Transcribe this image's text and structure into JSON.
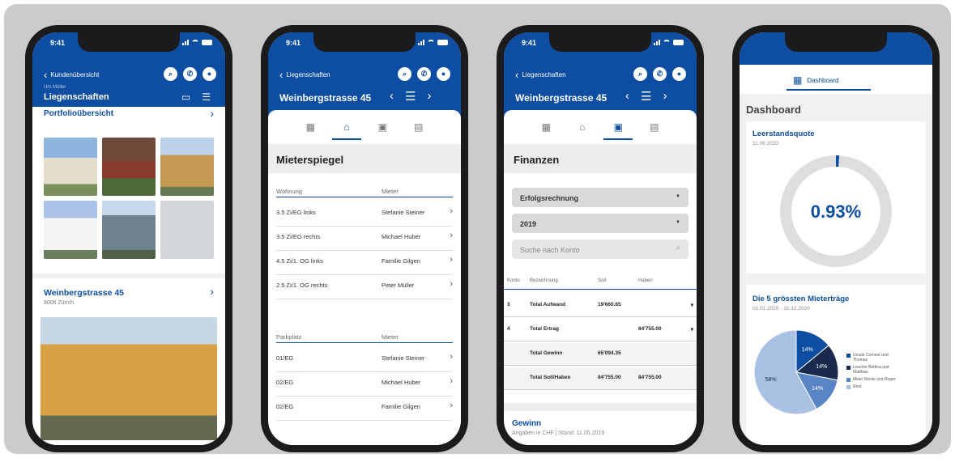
{
  "status": {
    "time": "9:41"
  },
  "colors": {
    "primary": "#0d4ea3",
    "dark_navy": "#1a2a4f",
    "mid_blue": "#5a85c4",
    "light_blue": "#a9c1e3",
    "ring_gray": "#dedede"
  },
  "screen1": {
    "back_label": "Kundenübersicht",
    "user": "Urs Müller",
    "title": "Liegenschaften",
    "section": "Portfolioübersicht",
    "property_name": "Weinbergstrasse 45",
    "property_city": "8006 Zürich",
    "icons": [
      "search-icon",
      "phone-icon",
      "user-icon",
      "monitor-icon",
      "list-icon"
    ]
  },
  "screen2": {
    "back_label": "Liegenschaften",
    "title": "Weinbergstrasse 45",
    "page_title": "Mieterspiegel",
    "col_unit": "Wohnung",
    "col_tenant": "Mieter",
    "apartments": [
      {
        "unit": "3.5 Zi/EG links",
        "tenant": "Stefanie Steiner"
      },
      {
        "unit": "3.5 Zi/EG rechts",
        "tenant": "Michael Huber"
      },
      {
        "unit": "4.5 Zi/1. OG links",
        "tenant": "Familie Gilgen"
      },
      {
        "unit": "2.5 Zi/1. OG rechts",
        "tenant": "Peter Müller"
      }
    ],
    "col_parking": "Parkplatz",
    "col_tenant2": "Mieter",
    "parking": [
      {
        "unit": "01/EG",
        "tenant": "Stefanie Steiner"
      },
      {
        "unit": "02/EG",
        "tenant": "Michael Huber"
      },
      {
        "unit": "02/EG",
        "tenant": "Familie Gilgen"
      }
    ]
  },
  "screen3": {
    "back_label": "Liegenschaften",
    "title": "Weinbergstrasse 45",
    "page_title": "Finanzen",
    "select_type": "Erfolgsrechnung",
    "select_year": "2019",
    "search_placeholder": "Suche nach Konto",
    "headers": {
      "konto": "Konto",
      "bez": "Bezeichnung",
      "soll": "Soll",
      "haben": "Haben"
    },
    "rows": [
      {
        "konto": "3",
        "bez": "Total Aufwand",
        "soll": "19'660.65",
        "haben": ""
      },
      {
        "konto": "4",
        "bez": "Total Ertrag",
        "soll": "",
        "haben": "84'755.00"
      },
      {
        "konto": "",
        "bez": "Total Gewinn",
        "soll": "65'094.35",
        "haben": ""
      },
      {
        "konto": "",
        "bez": "Total Soll/Haben",
        "soll": "84'755.00",
        "haben": "84'755.00"
      }
    ],
    "gewinn_title": "Gewinn",
    "gewinn_sub": "Angaben in CHF | Stand: 11.05.2019"
  },
  "screen4": {
    "tab_label": "Dashboard",
    "page_title": "Dashboard",
    "card1_title": "Leerstandsquote",
    "card1_date": "11.06.2020",
    "vacancy_value": "0.93%",
    "vacancy_fraction": 0.0093,
    "card2_title": "Die 5 grössten Mieterträge",
    "card2_date": "01.01.2020 - 31.12.2020",
    "chart_data": {
      "type": "pie",
      "slices": [
        {
          "label": "14%",
          "value": 14,
          "color": "#0d4ea3"
        },
        {
          "label": "14%",
          "value": 14,
          "color": "#1a2a4f"
        },
        {
          "label": "14%",
          "value": 14,
          "color": "#5a85c4"
        },
        {
          "label": "58%",
          "value": 58,
          "color": "#a9c1e3"
        }
      ],
      "legend": [
        "Ursula Cornner und Thomas",
        "Loscher Bettina und Matthias",
        "Meier Nicole und Roger",
        "Rest"
      ],
      "legend_position": "right"
    }
  }
}
